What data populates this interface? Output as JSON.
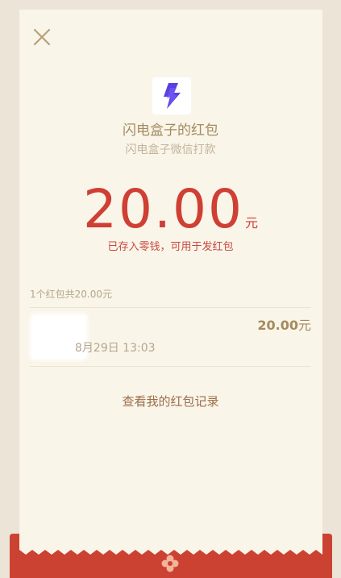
{
  "header": {
    "close_icon": "close-icon"
  },
  "sender": {
    "logo_icon": "lightning-bolt-icon",
    "name": "闪电盒子的红包",
    "subtitle": "闪电盒子微信打款"
  },
  "amount": {
    "value": "20.00",
    "unit": "元",
    "note": "已存入零钱，可用于发红包"
  },
  "summary": "1个红包共20.00元",
  "records": [
    {
      "time": "8月29日  13:03",
      "amount": "20.00",
      "unit": "元"
    }
  ],
  "record_link": "查看我的红包记录",
  "colors": {
    "amount_red": "#cf3f34",
    "gold_text": "#a48a5f",
    "band_red": "#cb4232",
    "card_bg": "#faf5e9",
    "page_bg": "#ece4d6"
  }
}
